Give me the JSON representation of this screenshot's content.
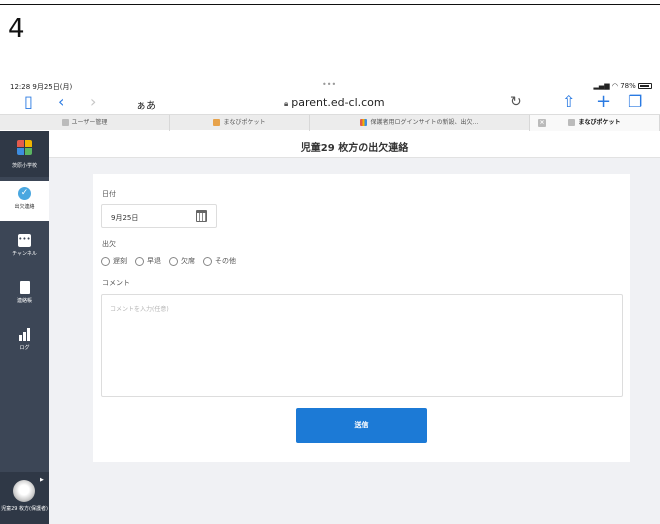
{
  "step_number": "4",
  "status_bar": {
    "time": "12:28  9月25日(月)",
    "dots": "•••",
    "battery": "78%"
  },
  "browser": {
    "aa_label": "ぁあ",
    "url": "parent.ed-cl.com",
    "tabs": [
      {
        "label": "ユーザー管理",
        "active": false
      },
      {
        "label": "まなびポケット",
        "active": false
      },
      {
        "label": "保護者用ログインサイトの新設、出欠…",
        "active": false
      },
      {
        "label": "まなびポケット",
        "active": true
      }
    ]
  },
  "sidebar": {
    "school_name": "茨原小学校",
    "items": [
      {
        "label": "出欠連絡",
        "icon": "check-circle-icon",
        "active": true
      },
      {
        "label": "チャンネル",
        "icon": "chat-icon",
        "active": false
      },
      {
        "label": "連絡帳",
        "icon": "document-icon",
        "active": false
      },
      {
        "label": "ログ",
        "icon": "bar-chart-icon",
        "active": false
      }
    ],
    "child_name": "児童29 枚方(保護者)"
  },
  "main": {
    "page_title": "児童29 枚方の出欠連絡",
    "date_label": "日付",
    "date_value": "9月25日",
    "attendance_label": "出欠",
    "attendance_options": [
      "遅刻",
      "早退",
      "欠席",
      "その他"
    ],
    "comment_label": "コメント",
    "comment_placeholder": "コメントを入力(任意)",
    "submit_label": "送信"
  },
  "colors": {
    "sidebar_bg": "#3c4656",
    "primary_button": "#1c7ad6",
    "browser_accent": "#2a7ae2"
  }
}
